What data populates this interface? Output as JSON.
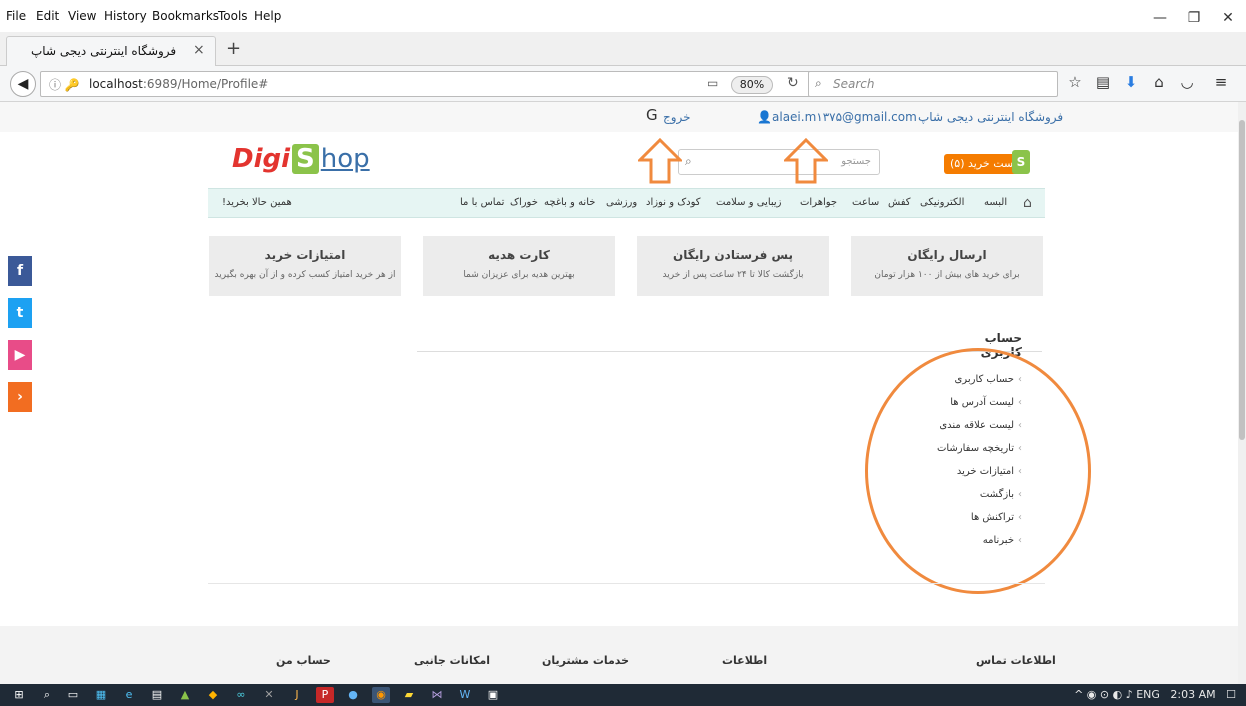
{
  "menubar": {
    "items": [
      {
        "label": "File"
      },
      {
        "label": "Edit"
      },
      {
        "label": "View"
      },
      {
        "label": "History"
      },
      {
        "label": "Bookmarks"
      },
      {
        "label": "Tools"
      },
      {
        "label": "Help"
      }
    ]
  },
  "tab": {
    "title": "فروشگاه اینترنتی دیجی شاپ",
    "close": "×",
    "new": "+"
  },
  "nav": {
    "url_host": "localhost",
    "url_rest": ":6989/Home/Profile#",
    "zoom": "80%",
    "search_placeholder": "Search"
  },
  "top": {
    "logout": "خروج",
    "email": "alaei.m۱۳۷۵@gmail.com",
    "store_title": "فروشگاه اینترنتی دیجی شاپ"
  },
  "header": {
    "logo_digi": "Digi",
    "logo_s": "S",
    "logo_hop": "hop",
    "search_placeholder": "جستجو",
    "cart": "لیست خرید (۵)",
    "bag": "S"
  },
  "categories": [
    {
      "label": "البسه"
    },
    {
      "label": "الکترونیکی"
    },
    {
      "label": "کفش"
    },
    {
      "label": "ساعت"
    },
    {
      "label": "جواهرات"
    },
    {
      "label": "زیبایی و سلامت"
    },
    {
      "label": "کودک و نوزاد"
    },
    {
      "label": "ورزشی"
    },
    {
      "label": "خانه و باغچه"
    },
    {
      "label": "خوراک"
    },
    {
      "label": "تماس با ما"
    }
  ],
  "buy_now": "همین حالا بخرید!",
  "features": [
    {
      "title": "ارسال رایگان",
      "desc": "برای خرید های بیش از ۱۰۰ هزار تومان"
    },
    {
      "title": "پس فرستادن رایگان",
      "desc": "بازگشت کالا تا ۲۴ ساعت پس از خرید"
    },
    {
      "title": "کارت هدیه",
      "desc": "بهترین هدیه برای عزیزان شما"
    },
    {
      "title": "امتیازات خرید",
      "desc": "از هر خرید امتیاز کسب کرده و از آن بهره بگیرید"
    }
  ],
  "account": {
    "title": "حساب کاربری",
    "menu": [
      {
        "label": "حساب کاربری"
      },
      {
        "label": "لیست آدرس ها"
      },
      {
        "label": "لیست علاقه مندی"
      },
      {
        "label": "تاریخچه سفارشات"
      },
      {
        "label": "امتیازات خرید"
      },
      {
        "label": "بازگشت"
      },
      {
        "label": "تراکنش ها"
      },
      {
        "label": "خبرنامه"
      }
    ]
  },
  "footer": {
    "contact": "اطلاعات تماس",
    "info": "اطلاعات",
    "customer": "خدمات مشتریان",
    "extras": "امکانات جانبی",
    "myaccount": "حساب من"
  },
  "tray": {
    "lang": "ENG",
    "time": "2:03 AM"
  },
  "colors": {
    "accent": "#f08a3e",
    "catbar": "#e6f5f3",
    "facebook": "#3b5998",
    "twitter": "#1da1f2",
    "youtube": "#e84c88",
    "more": "#f26d21"
  }
}
